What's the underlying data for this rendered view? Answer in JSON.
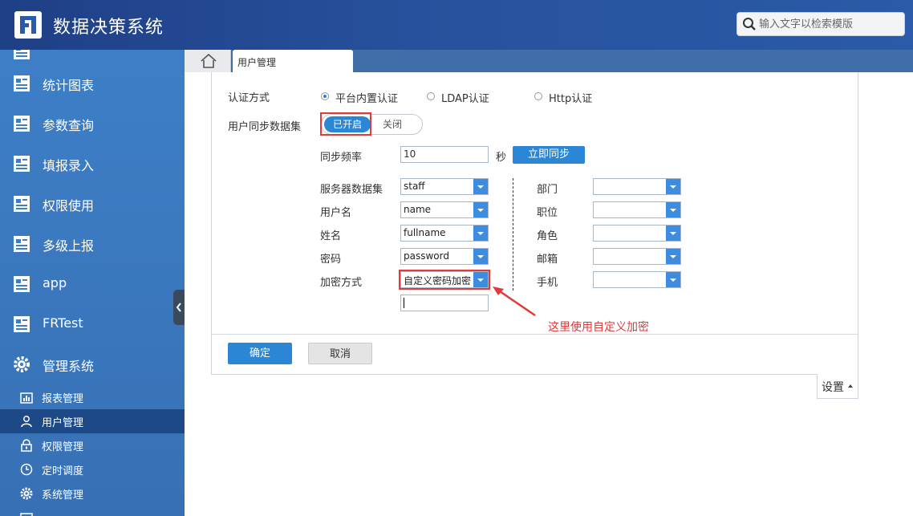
{
  "header": {
    "title": "数据决策系统",
    "search_placeholder": "输入文字以检索模版"
  },
  "sidebar": {
    "items": [
      {
        "label": "统计图表",
        "icon": "report-icon"
      },
      {
        "label": "参数查询",
        "icon": "report-icon"
      },
      {
        "label": "填报录入",
        "icon": "report-icon"
      },
      {
        "label": "权限使用",
        "icon": "report-icon"
      },
      {
        "label": "多级上报",
        "icon": "report-icon"
      },
      {
        "label": "app",
        "icon": "report-icon"
      },
      {
        "label": "FRTest",
        "icon": "report-icon"
      },
      {
        "label": "管理系统",
        "icon": "gear-icon"
      }
    ],
    "sub_items": [
      {
        "label": "报表管理",
        "icon": "chart-icon"
      },
      {
        "label": "用户管理",
        "icon": "user-icon"
      },
      {
        "label": "权限管理",
        "icon": "lock-icon"
      },
      {
        "label": "定时调度",
        "icon": "clock-icon"
      },
      {
        "label": "系统管理",
        "icon": "gear-icon"
      }
    ]
  },
  "tabs": {
    "active_label": "用户管理"
  },
  "auth": {
    "label": "认证方式",
    "options": [
      "平台内置认证",
      "LDAP认证",
      "Http认证"
    ],
    "selected": "平台内置认证"
  },
  "sync": {
    "label": "用户同步数据集",
    "toggle_on": "已开启",
    "toggle_off": "关闭",
    "freq_label": "同步频率",
    "freq_value": "10",
    "freq_unit": "秒",
    "sync_now": "立即同步"
  },
  "left_fields": [
    {
      "label": "服务器数据集",
      "value": "staff"
    },
    {
      "label": "用户名",
      "value": "name"
    },
    {
      "label": "姓名",
      "value": "fullname"
    },
    {
      "label": "密码",
      "value": "password"
    },
    {
      "label": "加密方式",
      "value": "自定义密码加密"
    }
  ],
  "right_fields": [
    {
      "label": "部门",
      "value": ""
    },
    {
      "label": "职位",
      "value": ""
    },
    {
      "label": "角色",
      "value": ""
    },
    {
      "label": "邮箱",
      "value": ""
    },
    {
      "label": "手机",
      "value": ""
    }
  ],
  "annotation": "这里使用自定义加密",
  "footer": {
    "ok": "确定",
    "cancel": "取消",
    "settings": "设置"
  },
  "colors": {
    "accent": "#2c86d6",
    "header": "#27519c",
    "sidebar": "#3d7fc7",
    "highlight": "#e03a3a"
  }
}
